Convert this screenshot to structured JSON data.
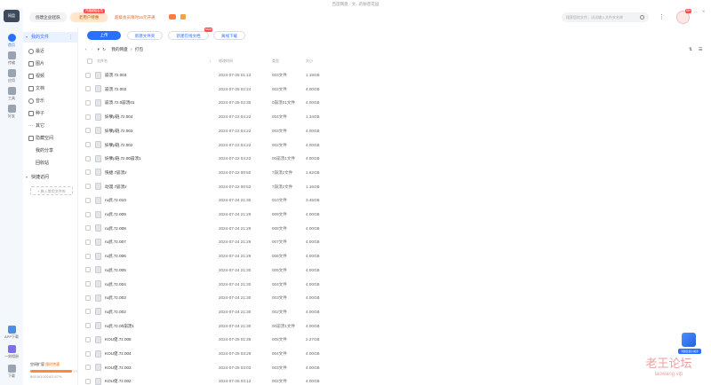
{
  "window": {
    "title": "百度网盘 - 文...的秘密花园"
  },
  "topbar": {
    "logo": "网盘",
    "team_button": "创建企业/团队",
    "vip_badge": "开通超级会员",
    "vip_button": "老用户特惠",
    "promo": "超级会员限时15元开通",
    "search_placeholder": "搜索您的文件，试试输入文件夹名称",
    "notification_count": "99+"
  },
  "rail": {
    "items": [
      {
        "label": "首页",
        "active": true
      },
      {
        "label": "传输",
        "active": false
      },
      {
        "label": "应用",
        "active": false
      },
      {
        "label": "工具",
        "active": false
      },
      {
        "label": "好友",
        "active": false
      }
    ],
    "bottom_items": [
      "APP下载",
      "一刻相册",
      "下载"
    ]
  },
  "sidebar": {
    "my_files": "我的文件",
    "categories": [
      "最近",
      "图片",
      "视频",
      "文档",
      "音乐",
      "种子",
      "其它",
      "隐藏空间"
    ],
    "my_shares": "我的分享",
    "recycle": "回收站",
    "quick_access": "快捷访问",
    "quick_add": "+ 拖入常用文件夹",
    "storage_label": "空间扩容",
    "storage_usage": "893.5G/1024G",
    "storage_promo": "限时特惠",
    "storage_percent": "87%"
  },
  "toolbar": {
    "upload": "上传",
    "new_folder": "新建文件夹",
    "new_online_doc": "新建在线文档",
    "new_badge": "NEW",
    "offline_download": "离线下载"
  },
  "breadcrumb": [
    "我的网盘",
    "打包"
  ],
  "table": {
    "headers": [
      "文件名",
      "修改时间",
      "类型",
      "大小"
    ],
    "rows": [
      {
        "name": "崩溃.7z.003",
        "date": "2024-07-25 01:13",
        "type": "003文件",
        "size": "1.19GB"
      },
      {
        "name": "崩溃.7z.002",
        "date": "2024-07-25 02:24",
        "type": "002文件",
        "size": "4.00GB"
      },
      {
        "name": "崩溃.7z.0崩溃01",
        "date": "2024-07-25 02:30",
        "type": "0崩溃01文件",
        "size": "4.00GB"
      },
      {
        "name": "妖孽p链.7z.004",
        "date": "2024-07-22 04:22",
        "type": "004文件",
        "size": "1.34GB"
      },
      {
        "name": "妖孽p链.7z.003",
        "date": "2024-07-22 04:22",
        "type": "003文件",
        "size": "4.00GB"
      },
      {
        "name": "妖孽p链.7z.002",
        "date": "2024-07-22 04:22",
        "type": "002文件",
        "size": "4.00GB"
      },
      {
        "name": "妖孽p链.7z.00崩溃1",
        "date": "2024-07-22 04:22",
        "type": "00崩溃1文件",
        "size": "4.00GB"
      },
      {
        "name": "快捷.7崩溃z",
        "date": "2024-07-22 00:50",
        "type": "7崩溃z文件",
        "size": "1.62GB"
      },
      {
        "name": "动漫.7崩溃z",
        "date": "2024-07-22 00:52",
        "type": "7崩溃z文件",
        "size": "1.16GB"
      },
      {
        "name": "ru武.7z.010",
        "date": "2024-07-24 21:30",
        "type": "010文件",
        "size": "3.45GB"
      },
      {
        "name": "ru武.7z.009",
        "date": "2024-07-24 21:29",
        "type": "009文件",
        "size": "4.00GB"
      },
      {
        "name": "ru武.7z.008",
        "date": "2024-07-24 21:29",
        "type": "008文件",
        "size": "4.00GB"
      },
      {
        "name": "ru武.7z.007",
        "date": "2024-07-24 21:29",
        "type": "007文件",
        "size": "4.00GB"
      },
      {
        "name": "ru武.7z.006",
        "date": "2024-07-24 21:29",
        "type": "006文件",
        "size": "4.00GB"
      },
      {
        "name": "ru武.7z.005",
        "date": "2024-07-24 21:30",
        "type": "005文件",
        "size": "4.00GB"
      },
      {
        "name": "ru武.7z.004",
        "date": "2024-07-24 21:30",
        "type": "004文件",
        "size": "4.00GB"
      },
      {
        "name": "ru武.7z.003",
        "date": "2024-07-24 21:30",
        "type": "003文件",
        "size": "4.00GB"
      },
      {
        "name": "ru武.7z.002",
        "date": "2024-07-24 21:30",
        "type": "002文件",
        "size": "4.00GB"
      },
      {
        "name": "ru武.7z.00崩溃1",
        "date": "2024-07-24 21:30",
        "type": "00崩溃1文件",
        "size": "4.00GB"
      },
      {
        "name": "KOU佬.7z.005",
        "date": "2024-07-25 01:36",
        "type": "005文件",
        "size": "2.27GB"
      },
      {
        "name": "KOU佬.7z.004",
        "date": "2024-07-25 03:29",
        "type": "004文件",
        "size": "4.00GB"
      },
      {
        "name": "KOU佬.7z.003",
        "date": "2024-07-25 03:03",
        "type": "003文件",
        "size": "4.00GB"
      },
      {
        "name": "KOU佬.7z.002",
        "date": "2024-07-25 03:12",
        "type": "002文件",
        "size": "4.00GB"
      }
    ]
  },
  "watermark": {
    "line1": "老王论坛",
    "line2": "laowang.vip"
  },
  "floating_helper": "问题反馈小助手",
  "colors": {
    "accent": "#2970ff",
    "vip_orange": "#ff6a00",
    "watermark": "#e05050"
  }
}
